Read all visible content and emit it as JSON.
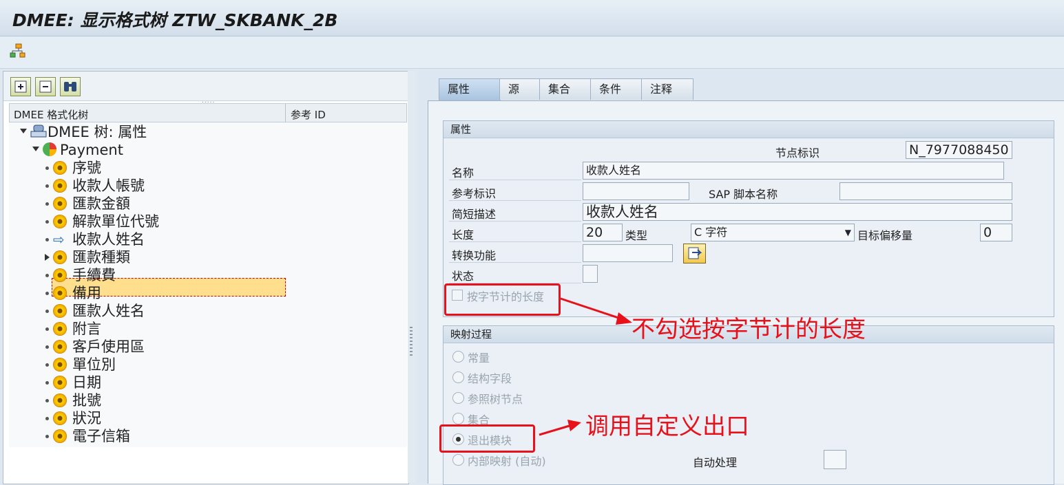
{
  "window": {
    "title": "DMEE: 显示格式树 ZTW_SKBANK_2B"
  },
  "toolbar": {
    "icon": "hierarchy-icon"
  },
  "tree_panel": {
    "col_name": "DMEE 格式化树",
    "col_ref": "参考 ID",
    "root": "DMEE 树: 属性",
    "segment": "Payment",
    "items": [
      "序號",
      "收款人帳號",
      "匯款金額",
      "解款單位代號",
      "收款人姓名",
      "匯款種類",
      "手續費",
      "備用",
      "匯款人姓名",
      "附言",
      "客戶使用區",
      "單位別",
      "日期",
      "批號",
      "狀況",
      "電子信箱"
    ],
    "selected_index": 4,
    "collapsed_index": 5
  },
  "tabs": [
    "属性",
    "源",
    "集合",
    "条件",
    "注释"
  ],
  "attributes": {
    "group_title": "属性",
    "node_id_label": "节点标识",
    "node_id_value": "N_7977088450",
    "name_label": "名称",
    "name_value": "收款人姓名",
    "ref_id_label": "参考标识",
    "ref_id_value": "",
    "sap_script_label": "SAP 脚本名称",
    "sap_script_value": "",
    "short_desc_label": "简短描述",
    "short_desc_value": "收款人姓名",
    "length_label": "长度",
    "length_value": "20",
    "type_label": "类型",
    "type_value": "C 字符",
    "offset_label": "目标偏移量",
    "offset_value": "0",
    "conversion_label": "转换功能",
    "conversion_value": "",
    "status_label": "状态",
    "byte_len_label": "按字节计的长度"
  },
  "mapping": {
    "group_title": "映射过程",
    "options": [
      "常量",
      "结构字段",
      "参照树节点",
      "集合",
      "退出模块",
      "内部映射 (自动)"
    ],
    "selected": "退出模块",
    "auto_label": "自动处理"
  },
  "annotations": {
    "note1": "不勾选按字节计的长度",
    "note2": "调用自定义出口"
  },
  "colors": {
    "annotation": "#e8101a",
    "selected_row": "#ffdf8e"
  }
}
